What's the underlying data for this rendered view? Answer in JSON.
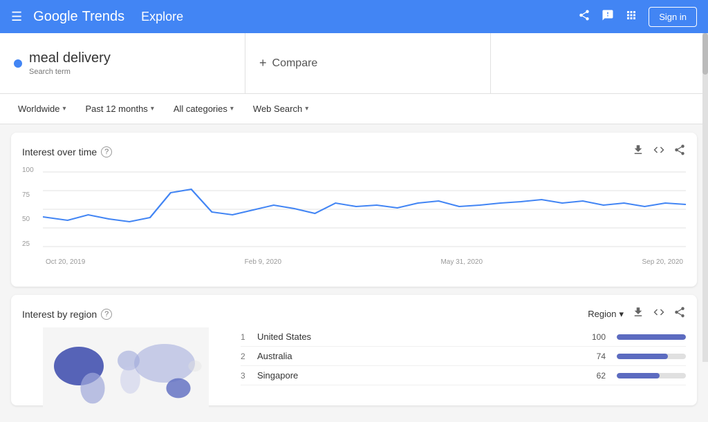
{
  "header": {
    "menu_label": "≡",
    "google_text": "Google",
    "trends_text": "Trends",
    "explore_label": "Explore",
    "share_icon": "share",
    "feedback_icon": "feedback",
    "apps_icon": "apps",
    "signin_label": "Sign in"
  },
  "search": {
    "term": "meal delivery",
    "term_type": "Search term",
    "compare_label": "Compare"
  },
  "filters": {
    "location": "Worldwide",
    "time": "Past 12 months",
    "category": "All categories",
    "type": "Web Search"
  },
  "interest_over_time": {
    "title": "Interest over time",
    "help": "?",
    "y_labels": [
      "100",
      "75",
      "50",
      "25"
    ],
    "x_labels": [
      "Oct 20, 2019",
      "Feb 9, 2020",
      "May 31, 2020",
      "Sep 20, 2020"
    ]
  },
  "interest_by_region": {
    "title": "Interest by region",
    "help": "?",
    "region_label": "Region",
    "regions": [
      {
        "rank": "1",
        "name": "United States",
        "value": "100",
        "bar_pct": 100
      },
      {
        "rank": "2",
        "name": "Australia",
        "value": "74",
        "bar_pct": 74
      },
      {
        "rank": "3",
        "name": "Singapore",
        "value": "62",
        "bar_pct": 62
      }
    ]
  }
}
